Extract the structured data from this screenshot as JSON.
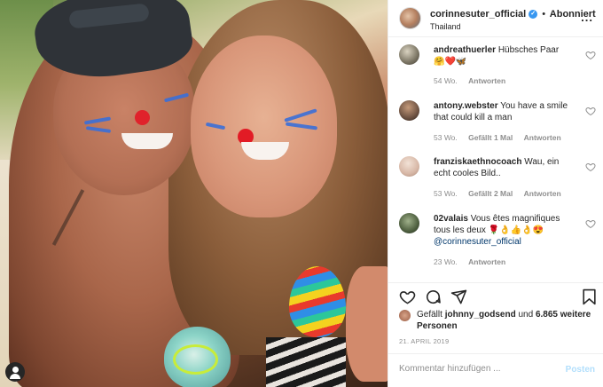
{
  "post": {
    "username": "corinnesuter_official",
    "separator": "•",
    "follow_label": "Abonniert",
    "location": "Thailand",
    "more": "..."
  },
  "comments": [
    {
      "username": "andreathuerler",
      "text": "Hübsches Paar",
      "emoji": "🤗❤️🦋",
      "time": "54 Wo.",
      "likes": "",
      "reply": "Antworten"
    },
    {
      "username": "antony.webster",
      "text": "You have a smile that could kill a man",
      "emoji": "",
      "time": "53 Wo.",
      "likes": "Gefällt 1 Mal",
      "reply": "Antworten"
    },
    {
      "username": "franziskaethnocoach",
      "text": "Wau, ein echt cooles Bild..",
      "emoji": "",
      "time": "53 Wo.",
      "likes": "Gefällt 2 Mal",
      "reply": "Antworten"
    },
    {
      "username": "02valais",
      "text": "Vous êtes magnifiques tous les deux",
      "emoji": "🌹👌👍👌😍",
      "mention": "@corinnesuter_official",
      "time": "23 Wo.",
      "likes": "",
      "reply": "Antworten"
    }
  ],
  "likes": {
    "prefix": "Gefällt",
    "user": "johnny_godsend",
    "joiner": "und",
    "others": "6.865 weitere Personen"
  },
  "date": "21. APRIL 2019",
  "comment_box": {
    "placeholder": "Kommentar hinzufügen ...",
    "post_label": "Posten"
  },
  "colors": {
    "verified": "#3897f0",
    "post_disabled": "#b2dffc",
    "meta": "#8e8e8e",
    "mention": "#00376b"
  },
  "icons": [
    "verified-icon",
    "heart-icon",
    "comment-icon",
    "share-icon",
    "bookmark-icon",
    "user-tag-icon"
  ]
}
